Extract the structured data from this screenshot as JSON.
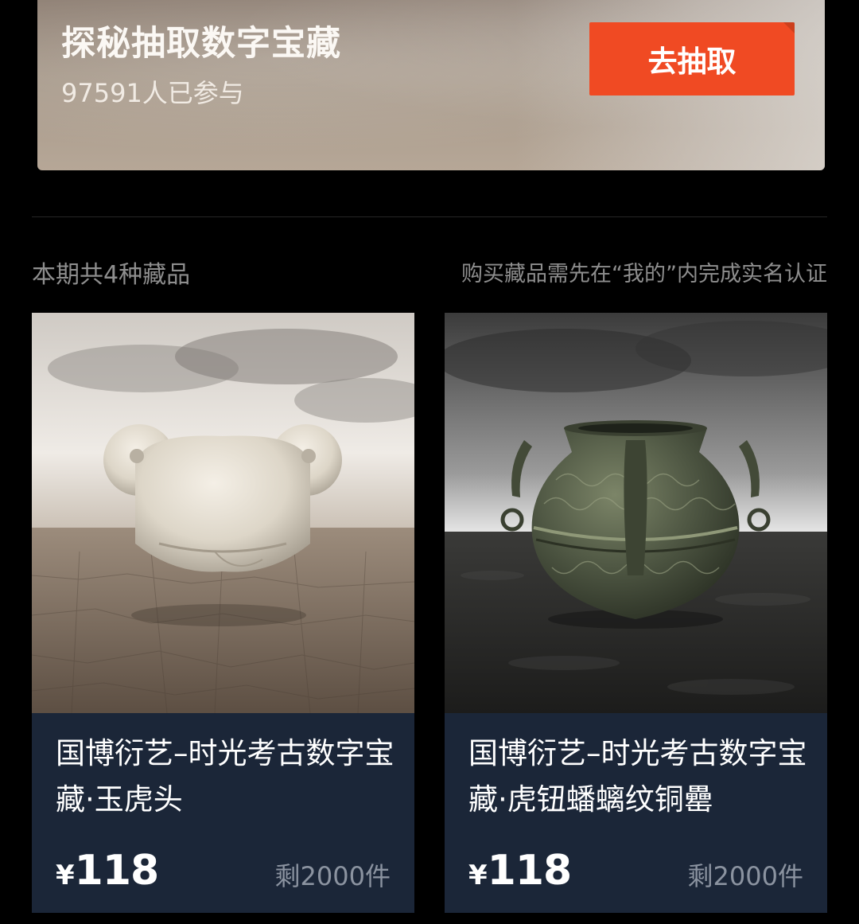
{
  "banner": {
    "title": "探秘抽取数字宝藏",
    "participants": "97591人已参与",
    "button_label": "去抽取"
  },
  "section": {
    "count_label": "本期共4种藏品",
    "notice": "购买藏品需先在“我的”内完成实名认证"
  },
  "products": [
    {
      "title": "国博衍艺–时光考古数字宝藏·玉虎头",
      "currency": "¥",
      "price": "118",
      "remaining": "剩2000件",
      "image_icon": "jade-tiger-head-image"
    },
    {
      "title": "国博衍艺–时光考古数字宝藏·虎钮蟠螭纹铜罍",
      "currency": "¥",
      "price": "118",
      "remaining": "剩2000件",
      "image_icon": "bronze-vessel-image"
    }
  ],
  "colors": {
    "accent_button": "#f04a23",
    "card_background": "#1b2638",
    "muted_text": "#8e8e8e"
  }
}
